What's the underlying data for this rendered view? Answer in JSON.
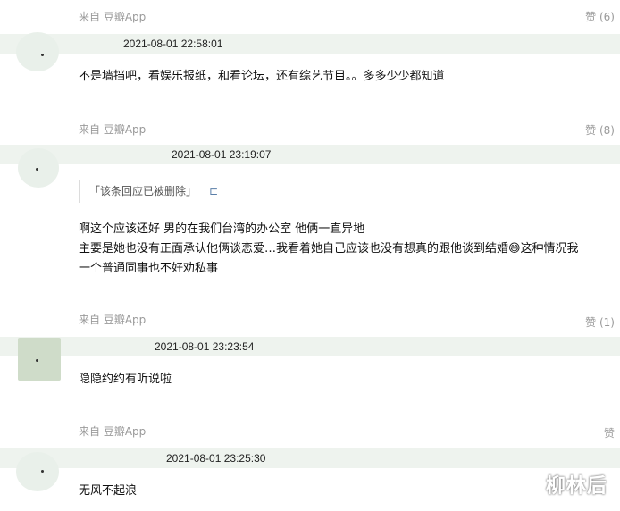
{
  "comments": [
    {
      "source": "来自 豆瓣App",
      "like": "赞 (6)",
      "time": "2021-08-01 22:58:01",
      "lines": [
        "不是墙挡吧，看娱乐报纸，和看论坛，还有综艺节目。。多多少少都知道"
      ]
    },
    {
      "source": "来自 豆瓣App",
      "like": "赞 (8)",
      "time": "2021-08-01 23:19:07",
      "quote": "「该条回应已被删除」",
      "quote_more": "⊏",
      "lines": [
        "啊这个应该还好 男的在我们台湾的办公室 他俩一直异地",
        "主要是她也没有正面承认他俩谈恋爱…我看着她自己应该也没有想真的跟他谈到结婚😅这种情况我",
        "一个普通同事也不好劝私事"
      ]
    },
    {
      "source": "来自 豆瓣App",
      "like": "赞 (1)",
      "time": "2021-08-01 23:23:54",
      "lines": [
        "隐隐约约有听说啦"
      ]
    },
    {
      "source": "来自 豆瓣App",
      "like": "赞",
      "time": "2021-08-01 23:25:30",
      "lines": [
        "无风不起浪"
      ]
    }
  ],
  "watermark": "柳林后"
}
